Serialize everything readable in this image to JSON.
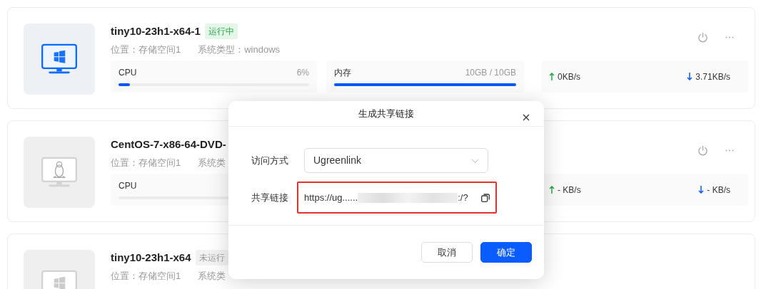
{
  "vms": [
    {
      "name": "tiny10-23h1-x64-1",
      "status": "运行中",
      "running": true,
      "kind": "windows",
      "location": "位置：存储空间1",
      "os_type": "系统类型：windows",
      "cpu": {
        "label": "CPU",
        "reading": "6%",
        "level": 0.06
      },
      "memory": {
        "label": "内存",
        "reading": "10GB / 10GB",
        "level": 1.0
      },
      "upload": "0KB/s",
      "download": "3.71KB/s"
    },
    {
      "name": "CentOS-7-x86-64-DVD-",
      "running": false,
      "kind": "linux",
      "location": "位置：存储空间1",
      "os_type": "系统类",
      "cpu": {
        "label": "CPU"
      },
      "upload": "- KB/s",
      "download": "- KB/s"
    },
    {
      "name": "tiny10-23h1-x64",
      "status": "未运行",
      "running": false,
      "kind": "windows",
      "location": "位置：存储空间1",
      "os_type": "系统类"
    }
  ],
  "dialog": {
    "title": "生成共享链接",
    "access_label": "访问方式",
    "access_value": "Ugreenlink",
    "link_label": "共享链接",
    "link_start": "https://ug......",
    "link_end": ":/?",
    "link_highlighted": true,
    "buttons": [
      {
        "label": "取消",
        "kind": "secondary"
      },
      {
        "label": "确定",
        "kind": "primary"
      }
    ]
  }
}
